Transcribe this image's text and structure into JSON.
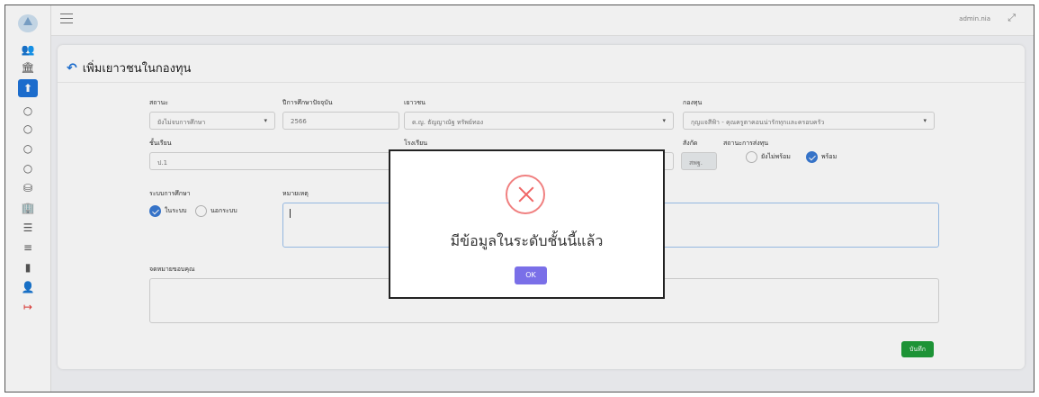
{
  "topbar": {
    "user": "admin.nia",
    "expand_icon": "expand-icon",
    "menu_icon": "hamburger-icon"
  },
  "sidebar": {
    "icons": [
      {
        "name": "users-icon",
        "glyph": "👥"
      },
      {
        "name": "bank-icon",
        "glyph": "🏛"
      },
      {
        "name": "upload-icon",
        "glyph": "⬆",
        "active": true
      },
      {
        "name": "circle-icon",
        "glyph": "○"
      },
      {
        "name": "circle-icon",
        "glyph": "○"
      },
      {
        "name": "circle-icon",
        "glyph": "○"
      },
      {
        "name": "circle-icon",
        "glyph": "○"
      },
      {
        "name": "database-icon",
        "glyph": "⛁"
      },
      {
        "name": "building-icon",
        "glyph": "🏢"
      },
      {
        "name": "server-icon",
        "glyph": "☰"
      },
      {
        "name": "list-icon",
        "glyph": "≡"
      },
      {
        "name": "file-icon",
        "glyph": "▮"
      },
      {
        "name": "user-settings-icon",
        "glyph": "👤"
      },
      {
        "name": "logout-icon",
        "glyph": "↦"
      }
    ]
  },
  "page": {
    "title": "เพิ่มเยาวชนในกองทุน"
  },
  "form": {
    "status_label": "สถานะ",
    "status_value": "ยังไม่จบการศึกษา",
    "year_label": "ปีการศึกษาปัจจุบัน",
    "year_value": "2566",
    "youth_label": "เยาวชน",
    "youth_value": "ด.ญ. ธัญญาณัฐ ทรัพย์ทอง",
    "fund_label": "กองทุน",
    "fund_value": "กุญแจสีฟ้า - คุณครูตาคอนน่ารักทุกและครอบครัว",
    "grade_label": "ชั้นเรียน",
    "grade_value": "ป.1",
    "school_label": "โรงเรียน",
    "affiliation_label": "สังกัด",
    "affiliation_value": "สพฐ.",
    "readiness_label": "สถานะการส่งทุน",
    "readiness_not_ready": "ยังไม่พร้อม",
    "readiness_ready": "พร้อม",
    "system_label": "ระบบการศึกษา",
    "system_in": "ในระบบ",
    "system_out": "นอกระบบ",
    "note_label": "หมายเหตุ",
    "thanks_label": "จดหมายขอบคุณ",
    "save_label": "บันทึก"
  },
  "modal": {
    "message": "มีข้อมูลในระดับชั้นนี้แล้ว",
    "ok_label": "OK",
    "icon": "error-x-icon"
  },
  "colors": {
    "primary": "#1e73d9",
    "success": "#1f9d3a",
    "danger": "#f06565",
    "modal_ok": "#7a6fe8"
  }
}
